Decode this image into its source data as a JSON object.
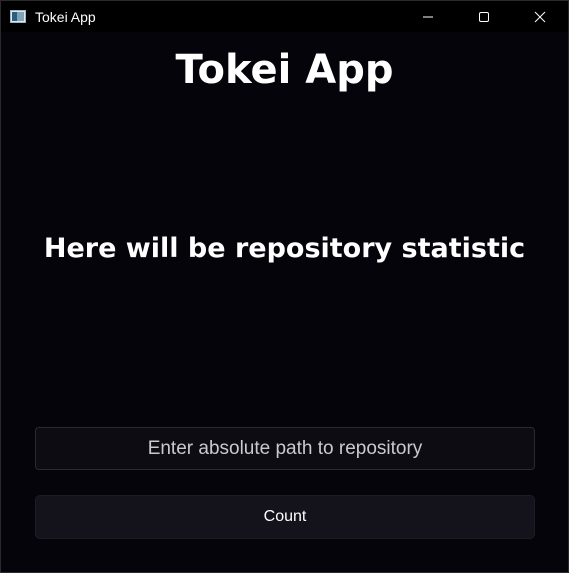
{
  "window": {
    "title": "Tokei App",
    "icon": "app-window-icon",
    "controls": [
      "minimize-icon",
      "maximize-icon",
      "close-icon"
    ]
  },
  "main": {
    "heading": "Tokei App",
    "statistics_placeholder": "Here will be repository statistic",
    "path_input": {
      "value": "",
      "placeholder": "Enter absolute path to repository"
    },
    "count_button_label": "Count"
  },
  "colors": {
    "background": "#05040a",
    "titlebar": "#000000",
    "text": "#ffffff",
    "input_background": "#0d0c13",
    "button_background": "#14131b"
  }
}
